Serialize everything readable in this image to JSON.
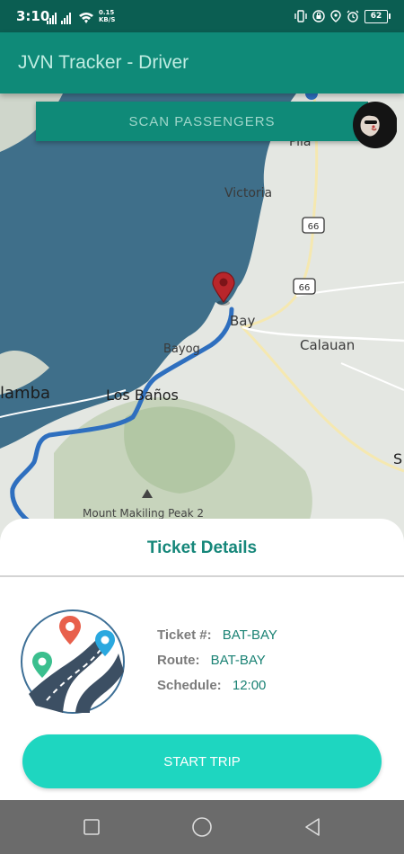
{
  "status_bar": {
    "time": "3:10",
    "net_speed_value": "0.15",
    "net_speed_unit": "KB/S",
    "battery": "62"
  },
  "app_bar": {
    "title": "JVN Tracker - Driver"
  },
  "map": {
    "labels": {
      "pila": "Pila",
      "victoria": "Victoria",
      "route_shield": "66",
      "bay": "Bay",
      "calauan": "Calauan",
      "bayog": "Bayog",
      "calamba": "lamba",
      "los_banos": "Los Baños",
      "mount": "Mount Makiling Peak 2",
      "edge": "S"
    }
  },
  "scan_button": {
    "label": "SCAN PASSENGERS"
  },
  "ticket_sheet": {
    "title": "Ticket Details",
    "ticket_label": "Ticket #:",
    "ticket_value": "BAT-BAY",
    "route_label": "Route:",
    "route_value": "BAT-BAY",
    "schedule_label": "Schedule:",
    "schedule_value": "12:00",
    "start_button": "START TRIP"
  },
  "colors": {
    "primary": "#0f8a78",
    "accent": "#1ed6c0",
    "water": "#3f6f8a"
  }
}
